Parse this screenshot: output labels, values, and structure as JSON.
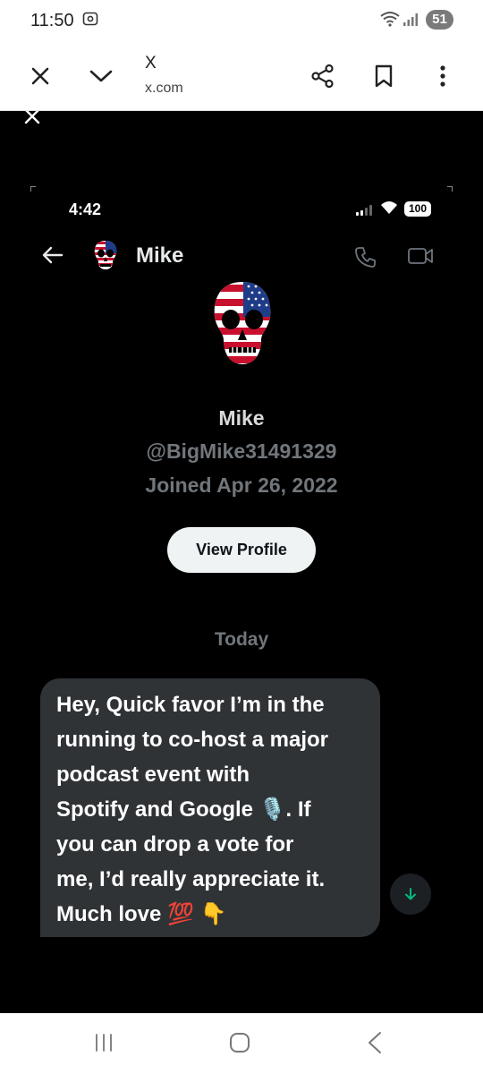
{
  "status_bar": {
    "time": "11:50",
    "battery": "51"
  },
  "browser": {
    "title": "X",
    "url": "x.com"
  },
  "inner_status": {
    "time": "4:42",
    "battery": "100"
  },
  "dm_header": {
    "name": "Mike"
  },
  "profile": {
    "name": "Mike",
    "handle": "@BigMike31491329",
    "joined": "Joined Apr 26, 2022",
    "view_profile_label": "View Profile"
  },
  "conversation": {
    "day_label": "Today",
    "message_lines": [
      "Hey, Quick favor I’m in the",
      "running to co-host a major",
      "podcast event with",
      "Spotify and Google 🎙️. If",
      "you can drop a vote for",
      "me, I’d really appreciate it.",
      "Much love 💯 👇"
    ]
  },
  "colors": {
    "background": "#000000",
    "bubble": "#2f3336",
    "muted_text": "#71767b",
    "scroll_arrow": "#00ba7c"
  },
  "icons": [
    "close-icon",
    "chevron-down-icon",
    "share-icon",
    "bookmark-icon",
    "more-vert-icon",
    "back-arrow-icon",
    "phone-icon",
    "video-icon",
    "arrow-down-icon",
    "recents-icon",
    "home-icon",
    "nav-back-icon"
  ]
}
